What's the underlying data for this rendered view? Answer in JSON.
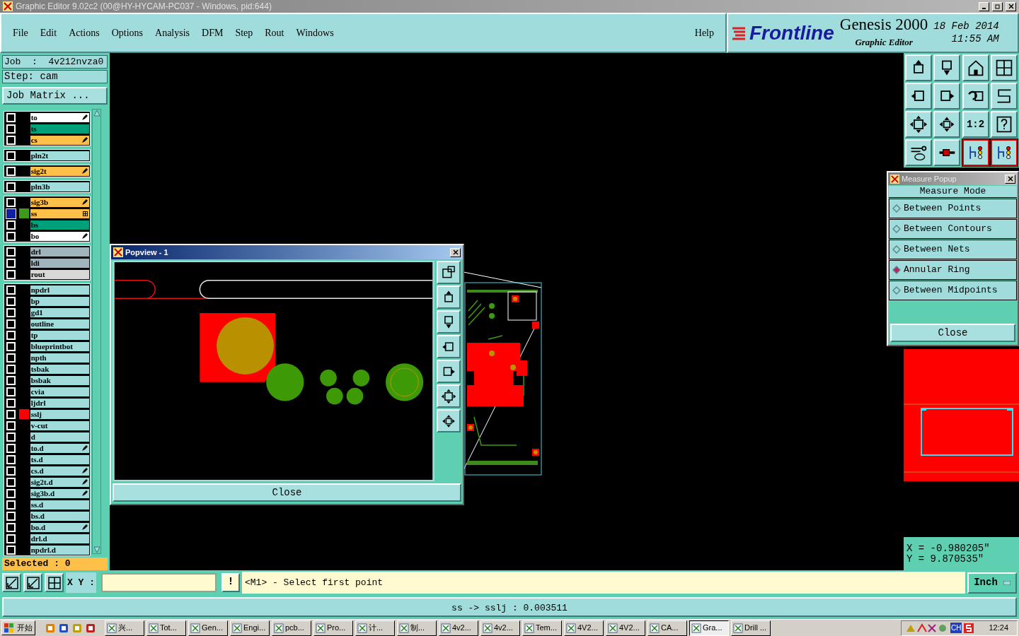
{
  "window": {
    "title": "Graphic Editor 9.02c2 (00@HY-HYCAM-PC037 - Windows, pid:644)"
  },
  "menu": [
    "File",
    "Edit",
    "Actions",
    "Options",
    "Analysis",
    "DFM",
    "Step",
    "Rout",
    "Windows"
  ],
  "help": "Help",
  "brand": {
    "logo": "Frontline",
    "product": "Genesis 2000",
    "subtitle": "Graphic Editor",
    "date": "18 Feb 2014",
    "time": "11:55 AM"
  },
  "job": {
    "job": "Job  :  4v212nvza0",
    "step": "Step: cam",
    "matrix_button": "Job Matrix ..."
  },
  "layer_groups": [
    [
      {
        "name": "to",
        "kind": "silk",
        "affected": true,
        "selected": false
      },
      {
        "name": "ts",
        "kind": "mask",
        "affected": false,
        "selected": false
      },
      {
        "name": "cs",
        "kind": "signal",
        "affected": true,
        "selected": false
      }
    ],
    [
      {
        "name": "pln2t",
        "kind": "plane",
        "affected": false,
        "selected": false
      }
    ],
    [
      {
        "name": "sig2t",
        "kind": "signal",
        "affected": true,
        "selected": false
      }
    ],
    [
      {
        "name": "pln3b",
        "kind": "plane",
        "affected": false,
        "selected": false
      }
    ],
    [
      {
        "name": "sig3b",
        "kind": "signal",
        "affected": true,
        "selected": false
      },
      {
        "name": "ss",
        "kind": "signal",
        "affected": false,
        "selected": true,
        "color": "#3f9a1c"
      },
      {
        "name": "bs",
        "kind": "mask",
        "affected": false,
        "selected": false
      },
      {
        "name": "bo",
        "kind": "silk",
        "affected": true,
        "selected": false
      }
    ],
    [
      {
        "name": "drl",
        "kind": "drill",
        "affected": false,
        "selected": false
      },
      {
        "name": "ldi",
        "kind": "drill",
        "affected": false,
        "selected": false
      },
      {
        "name": "rout",
        "kind": "rout",
        "affected": false,
        "selected": false
      }
    ],
    [
      {
        "name": "npdrl",
        "kind": "misc",
        "affected": false,
        "selected": false
      },
      {
        "name": "bp",
        "kind": "misc",
        "affected": false,
        "selected": false
      },
      {
        "name": "gd1",
        "kind": "misc",
        "affected": false,
        "selected": false
      },
      {
        "name": "outline",
        "kind": "misc",
        "affected": false,
        "selected": false
      },
      {
        "name": "tp",
        "kind": "misc",
        "affected": false,
        "selected": false
      },
      {
        "name": "blueprintbot",
        "kind": "misc",
        "affected": false,
        "selected": false
      },
      {
        "name": "npth",
        "kind": "misc",
        "affected": false,
        "selected": false
      },
      {
        "name": "tsbak",
        "kind": "misc",
        "affected": false,
        "selected": false
      },
      {
        "name": "bsbak",
        "kind": "misc",
        "affected": false,
        "selected": false
      },
      {
        "name": "cvia",
        "kind": "misc",
        "affected": false,
        "selected": false
      },
      {
        "name": "ljdrl",
        "kind": "misc",
        "affected": false,
        "selected": false
      },
      {
        "name": "sslj",
        "kind": "misc",
        "affected": false,
        "selected": false,
        "color": "#ff0000"
      },
      {
        "name": "v-cut",
        "kind": "misc",
        "affected": false,
        "selected": false
      },
      {
        "name": "d",
        "kind": "misc",
        "affected": false,
        "selected": false
      },
      {
        "name": "to.d",
        "kind": "misc",
        "affected": true,
        "selected": false
      },
      {
        "name": "ts.d",
        "kind": "misc",
        "affected": false,
        "selected": false
      },
      {
        "name": "cs.d",
        "kind": "misc",
        "affected": true,
        "selected": false
      },
      {
        "name": "sig2t.d",
        "kind": "misc",
        "affected": true,
        "selected": false
      },
      {
        "name": "sig3b.d",
        "kind": "misc",
        "affected": true,
        "selected": false
      },
      {
        "name": "ss.d",
        "kind": "misc",
        "affected": false,
        "selected": false
      },
      {
        "name": "bs.d",
        "kind": "misc",
        "affected": false,
        "selected": false
      },
      {
        "name": "bo.d",
        "kind": "misc",
        "affected": true,
        "selected": false
      },
      {
        "name": "drl.d",
        "kind": "misc",
        "affected": false,
        "selected": false
      },
      {
        "name": "npdrl.d",
        "kind": "misc",
        "affected": false,
        "selected": false
      }
    ]
  ],
  "selected_count": "Selected : 0",
  "tools": [
    {
      "kind": "page-up",
      "selected": false
    },
    {
      "kind": "page-down",
      "selected": false
    },
    {
      "kind": "home",
      "selected": false
    },
    {
      "kind": "grid",
      "selected": false
    },
    {
      "kind": "page-left",
      "selected": false
    },
    {
      "kind": "page-right",
      "selected": false
    },
    {
      "kind": "undo",
      "selected": false
    },
    {
      "kind": "zigzag",
      "selected": false
    },
    {
      "kind": "zoom-fit",
      "selected": false
    },
    {
      "kind": "move",
      "selected": false
    },
    {
      "kind": "scale",
      "label": "1:2",
      "selected": false
    },
    {
      "kind": "help",
      "selected": false
    },
    {
      "kind": "tools",
      "selected": false
    },
    {
      "kind": "probe",
      "selected": false
    },
    {
      "kind": "circuit",
      "selected": true
    },
    {
      "kind": "circuit",
      "selected": true
    }
  ],
  "measure": {
    "title": "Measure Popup",
    "header": "Measure Mode",
    "options": [
      {
        "label": "Between Points",
        "selected": false
      },
      {
        "label": "Between Contours",
        "selected": false
      },
      {
        "label": "Between Nets",
        "selected": false
      },
      {
        "label": "Annular Ring",
        "selected": true
      },
      {
        "label": "Between Midpoints",
        "selected": false
      }
    ],
    "close": "Close"
  },
  "coords": {
    "x": "X = -0.980205\"",
    "y": "Y = 9.870535\""
  },
  "popview": {
    "title": "Popview - 1",
    "close": "Close",
    "tools": [
      {
        "kind": "window"
      },
      {
        "kind": "page-up"
      },
      {
        "kind": "page-down"
      },
      {
        "kind": "page-left"
      },
      {
        "kind": "page-right"
      },
      {
        "kind": "zoom-fit"
      },
      {
        "kind": "move"
      }
    ]
  },
  "command": {
    "xy_label": "X Y :",
    "bang": "!",
    "prompt": "<M1> - Select first point",
    "units": "Inch"
  },
  "status": "ss -> sslj : 0.003511",
  "taskbar": {
    "start": "开始",
    "tasks": [
      {
        "label": "兴...",
        "selected": false
      },
      {
        "label": "Tot...",
        "selected": false
      },
      {
        "label": "Gen...",
        "selected": false
      },
      {
        "label": "Engi...",
        "selected": false
      },
      {
        "label": "pcb...",
        "selected": false
      },
      {
        "label": "Pro...",
        "selected": false
      },
      {
        "label": "计...",
        "selected": false
      },
      {
        "label": "制...",
        "selected": false
      },
      {
        "label": "4v2...",
        "selected": false
      },
      {
        "label": "4v2...",
        "selected": false
      },
      {
        "label": "Tem...",
        "selected": false
      },
      {
        "label": "4V2...",
        "selected": false
      },
      {
        "label": "4V2...",
        "selected": false
      },
      {
        "label": "CA...",
        "selected": false
      },
      {
        "label": "Gra...",
        "selected": true
      },
      {
        "label": "Drill ...",
        "selected": false
      }
    ],
    "lang": "CH",
    "time": "12:24"
  }
}
